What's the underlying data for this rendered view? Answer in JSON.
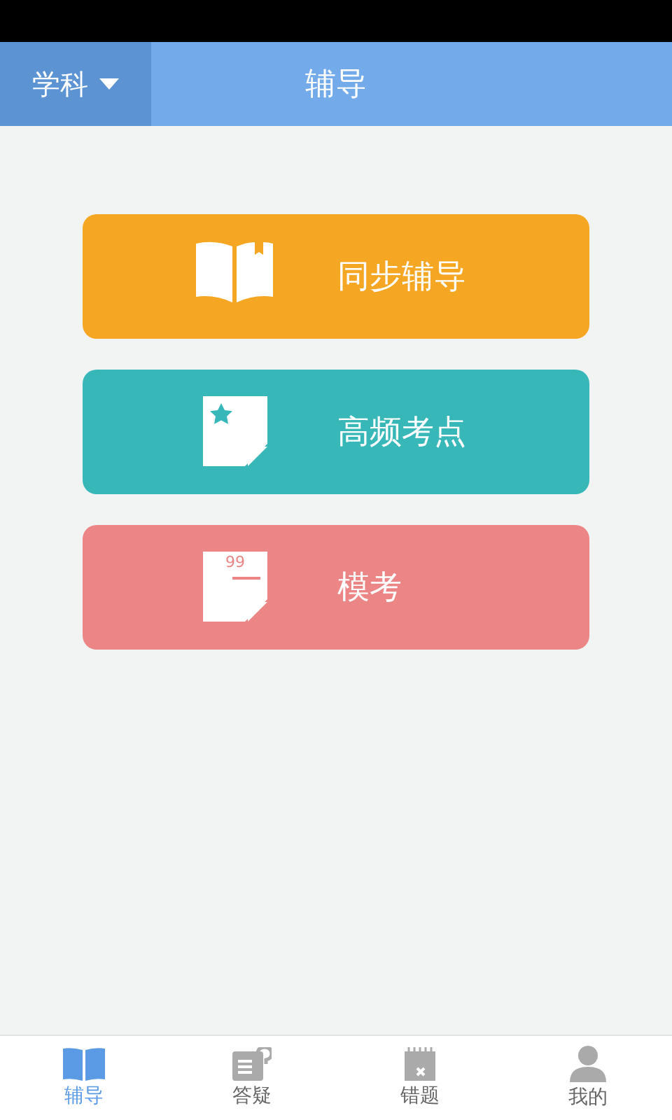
{
  "header": {
    "subject_menu": "学科",
    "title": "辅导"
  },
  "cards": [
    {
      "kind": "book",
      "label": "同步辅导",
      "color": "#f5a623"
    },
    {
      "kind": "star-page",
      "label": "高频考点",
      "color": "#38b7b9"
    },
    {
      "kind": "score-page",
      "label": "模考",
      "color": "#ec8585",
      "icon_text": "99"
    }
  ],
  "tabs": [
    {
      "kind": "book",
      "label": "辅导",
      "selected": true
    },
    {
      "kind": "question",
      "label": "答疑",
      "selected": false
    },
    {
      "kind": "calendar",
      "label": "错题",
      "selected": false
    },
    {
      "kind": "person",
      "label": "我的",
      "selected": false
    }
  ]
}
